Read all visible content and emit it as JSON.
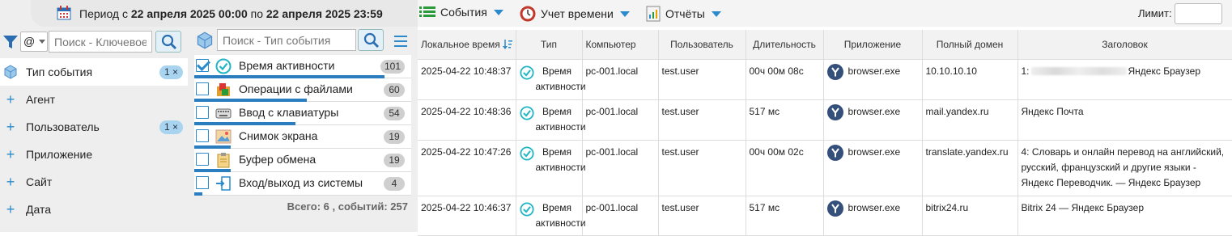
{
  "period": {
    "prefix": "Период с",
    "from": "22 апреля 2025 00:00",
    "middle": "по",
    "to": "22 апреля 2025 23:59"
  },
  "toolbar": {
    "events": "События",
    "time_tracking": "Учет времени",
    "reports": "Отчёты",
    "limit_label": "Лимит:",
    "limit_value": ""
  },
  "filter": {
    "mode": "@",
    "search_placeholder": "Поиск - Ключевое",
    "items": [
      {
        "label": "Тип события",
        "badge": "1 ×"
      },
      {
        "label": "Агент"
      },
      {
        "label": "Пользователь",
        "badge": "1 ×"
      },
      {
        "label": "Приложение"
      },
      {
        "label": "Сайт"
      },
      {
        "label": "Дата"
      }
    ]
  },
  "event_types": {
    "search_placeholder": "Поиск - Тип события",
    "items": [
      {
        "name": "Время активности",
        "count": "101",
        "checked": true,
        "share": 1.0
      },
      {
        "name": "Операции с файлами",
        "count": "60",
        "checked": false,
        "share": 0.59
      },
      {
        "name": "Ввод с клавиатуры",
        "count": "54",
        "checked": false,
        "share": 0.53
      },
      {
        "name": "Снимок экрана",
        "count": "19",
        "checked": false,
        "share": 0.19
      },
      {
        "name": "Буфер обмена",
        "count": "19",
        "checked": false,
        "share": 0.19
      },
      {
        "name": "Вход/выход из системы",
        "count": "4",
        "checked": false,
        "share": 0.04
      }
    ],
    "total": "Всего: 6 , событий: 257"
  },
  "grid": {
    "columns": [
      "Локальное время",
      "Тип",
      "Компьютер",
      "Пользователь",
      "Длительность",
      "Приложение",
      "Полный домен",
      "Заголовок"
    ],
    "rows": [
      {
        "time": "2025-04-22 10:48:37",
        "type": "Время активности",
        "computer": "pc-001.local",
        "user": "test.user",
        "duration": "00ч 00м 08с",
        "app": "browser.exe",
        "domain": "10.10.10.10",
        "title_prefix": "1:",
        "title": "Яндекс Браузер"
      },
      {
        "time": "2025-04-22 10:48:36",
        "type": "Время активности",
        "computer": "pc-001.local",
        "user": "test.user",
        "duration": "517 мс",
        "app": "browser.exe",
        "domain": "mail.yandex.ru",
        "title_prefix": "",
        "title": "Яндекс Почта"
      },
      {
        "time": "2025-04-22 10:47:26",
        "type": "Время активности",
        "computer": "pc-001.local",
        "user": "test.user",
        "duration": "00ч 00м 02с",
        "app": "browser.exe",
        "domain": "translate.yandex.ru",
        "title_prefix": "",
        "title": "4: Словарь и онлайн перевод на английский, русский, французский и другие языки  - Яндекс Переводчик. — Яндекс Браузер"
      },
      {
        "time": "2025-04-22 10:46:37",
        "type": "Время активности",
        "computer": "pc-001.local",
        "user": "test.user",
        "duration": "517 мс",
        "app": "browser.exe",
        "domain": "bitrix24.ru",
        "title_prefix": "",
        "title": "Bitrix 24 — Яндекс Браузер"
      }
    ]
  },
  "colors": {
    "accent": "#2a8acb",
    "bar": "#2a7ec0",
    "badge": "#a9d4f0"
  }
}
